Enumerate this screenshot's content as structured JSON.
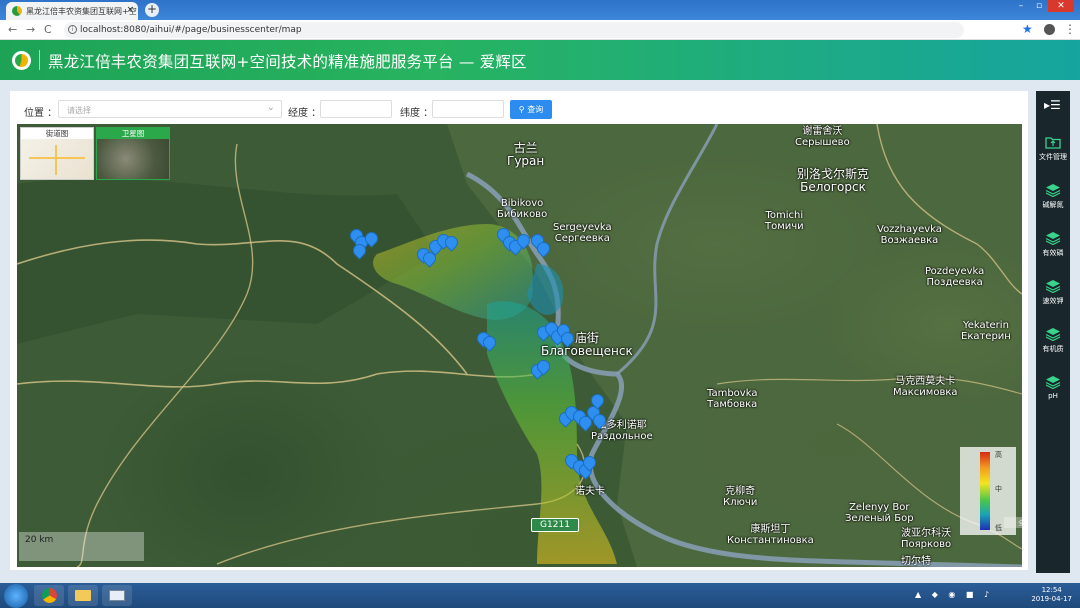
{
  "browser": {
    "tab_title": "黑龙江倍丰农资集团互联网+空",
    "tab_close": "×",
    "new_tab": "+",
    "url": "localhost:8080/aihui/#/page/businesscenter/map",
    "nav_back": "←",
    "nav_forward": "→",
    "nav_reload": "C",
    "win_min": "–",
    "win_max": "▫",
    "win_close": "✕",
    "bookmark_icon": "star-icon",
    "menu": "⋮"
  },
  "header": {
    "title": "黑龙江倍丰农资集团互联网+空间技术的精准施肥服务平台 — 爱辉区"
  },
  "filter": {
    "location_label": "位置 ：",
    "location_placeholder": "请选择",
    "longitude_label": "经度 ：",
    "longitude_value": "",
    "latitude_label": "纬度 ：",
    "latitude_value": "",
    "query_button": "查询"
  },
  "map": {
    "switcher": {
      "street": "街道图",
      "satellite": "卫星图",
      "active": "satellite"
    },
    "scale": "20 km",
    "legend": {
      "high": "高",
      "mid": "中",
      "low": "低"
    },
    "fullscreen": "全屏地图",
    "road_badge": "G1211",
    "place_labels": [
      {
        "zh": "谢雷舍沃",
        "ru": "Серышево"
      },
      {
        "zh": "古兰",
        "ru": "Гуран"
      },
      {
        "zh": "别洛戈尔斯克",
        "ru": "Белогорск"
      },
      {
        "zh": "Bibikovo",
        "ru": "Бибиково"
      },
      {
        "zh": "Sergeyevka",
        "ru": "Сергеевка"
      },
      {
        "zh": "Tomichi",
        "ru": "Томичи"
      },
      {
        "zh": "Vozzhayevka",
        "ru": "Возжаевка"
      },
      {
        "zh": "Pozdeyevka",
        "ru": "Поздеевка"
      },
      {
        "zh": "Yekaterin",
        "ru": "Екатерин"
      },
      {
        "zh": "庙街",
        "ru": "Благовещенск"
      },
      {
        "zh": "Tambovka",
        "ru": "Тамбовка"
      },
      {
        "zh": "马克西莫夫卡",
        "ru": "Максимовка"
      },
      {
        "zh": "兹多利诺耶",
        "ru": "Раздольное"
      },
      {
        "zh": "克柳奇",
        "ru": "Ключи"
      },
      {
        "zh": "Zelenyy Bor",
        "ru": "Зеленый Бор"
      },
      {
        "zh": "康斯坦丁",
        "ru": "Константиновка"
      },
      {
        "zh": "波亚尔科沃",
        "ru": "Поярково"
      },
      {
        "zh": "诺夫卡",
        "ru": ""
      },
      {
        "zh": "切尔特",
        "ru": ""
      }
    ]
  },
  "tools": [
    {
      "label": "文件管理",
      "icon": "folder-upload-icon"
    },
    {
      "label": "碱解氮",
      "icon": "layers-icon"
    },
    {
      "label": "有效磷",
      "icon": "layers-icon"
    },
    {
      "label": "速效钾",
      "icon": "layers-icon"
    },
    {
      "label": "有机质",
      "icon": "layers-icon"
    },
    {
      "label": "pH",
      "icon": "layers-icon"
    }
  ],
  "taskbar": {
    "time": "12:54",
    "date": "2019-04-17"
  },
  "colors": {
    "header_green": "#1da356",
    "query_blue": "#2d8cf0",
    "panel_dark": "#19272c",
    "marker_blue": "#2e8ff0"
  }
}
